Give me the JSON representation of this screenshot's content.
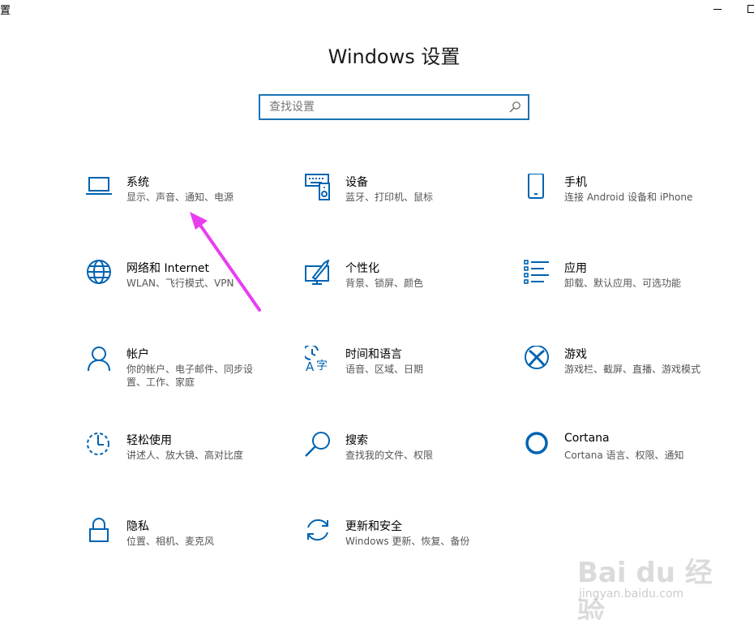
{
  "window": {
    "title_fragment": "置"
  },
  "header": {
    "title": "Windows 设置"
  },
  "search": {
    "placeholder": "查找设置"
  },
  "tiles": [
    {
      "title": "系统",
      "desc": "显示、声音、通知、电源",
      "icon": "laptop-icon"
    },
    {
      "title": "设备",
      "desc": "蓝牙、打印机、鼠标",
      "icon": "keyboard-speaker-icon"
    },
    {
      "title": "手机",
      "desc": "连接 Android 设备和 iPhone",
      "icon": "phone-icon"
    },
    {
      "title": "网络和 Internet",
      "desc": "WLAN、飞行模式、VPN",
      "icon": "globe-icon"
    },
    {
      "title": "个性化",
      "desc": "背景、锁屏、颜色",
      "icon": "paintbrush-monitor-icon"
    },
    {
      "title": "应用",
      "desc": "卸载、默认应用、可选功能",
      "icon": "app-list-icon"
    },
    {
      "title": "帐户",
      "desc": "你的帐户、电子邮件、同步设置、工作、家庭",
      "icon": "person-icon"
    },
    {
      "title": "时间和语言",
      "desc": "语音、区域、日期",
      "icon": "time-language-icon"
    },
    {
      "title": "游戏",
      "desc": "游戏栏、截屏、直播、游戏模式",
      "icon": "xbox-icon"
    },
    {
      "title": "轻松使用",
      "desc": "讲述人、放大镜、高对比度",
      "icon": "ease-of-access-icon"
    },
    {
      "title": "搜索",
      "desc": "查找我的文件、权限",
      "icon": "search-magnifier-icon"
    },
    {
      "title": "Cortana",
      "desc": "Cortana 语言、权限、通知",
      "icon": "cortana-ring-icon"
    },
    {
      "title": "隐私",
      "desc": "位置、相机、麦克风",
      "icon": "lock-icon"
    },
    {
      "title": "更新和安全",
      "desc": "Windows 更新、恢复、备份",
      "icon": "sync-arrows-icon"
    }
  ],
  "watermark": {
    "brand": "Bai du 经验",
    "url": "jingyan.baidu.com"
  },
  "colors": {
    "accent": "#0063b1",
    "search_border": "#1a73b5",
    "annotation_arrow": "#e83ef0"
  }
}
